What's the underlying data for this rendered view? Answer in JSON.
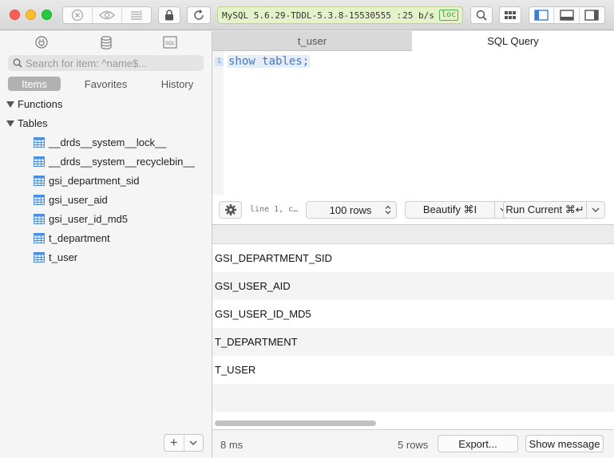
{
  "toolbar": {
    "connection": "MySQL 5.6.29-TDDL-5.3.8-15530555 :…",
    "rate": "25 b/s",
    "loc_badge": "loc",
    "colors": {
      "status_bg": "#e6f2c9",
      "accent": "#4a8fe0"
    }
  },
  "sidebar": {
    "search_placeholder": "Search for item: ^name$...",
    "tabs": [
      "Items",
      "Favorites",
      "History"
    ],
    "sections": {
      "functions": "Functions",
      "tables": "Tables"
    },
    "tables": [
      "__drds__system__lock__",
      "__drds__system__recyclebin__",
      "gsi_department_sid",
      "gsi_user_aid",
      "gsi_user_id_md5",
      "t_department",
      "t_user"
    ],
    "add_label": "+",
    "icons": {
      "connection": "plug-icon",
      "database": "database-icon",
      "sql": "sql-icon"
    }
  },
  "main": {
    "tabs": [
      "t_user",
      "SQL Query"
    ],
    "editor": {
      "line_number": "1",
      "code": "show tables;"
    },
    "query_bar": {
      "position": "line 1, c…",
      "rows": "100 rows",
      "beautify": "Beautify ⌘I",
      "run": "Run Current ⌘↵"
    },
    "results": [
      "GSI_DEPARTMENT_SID",
      "GSI_USER_AID",
      "GSI_USER_ID_MD5",
      "T_DEPARTMENT",
      "T_USER"
    ],
    "footer": {
      "time": "8 ms",
      "rows": "5 rows",
      "export": "Export...",
      "show_message": "Show message"
    }
  }
}
